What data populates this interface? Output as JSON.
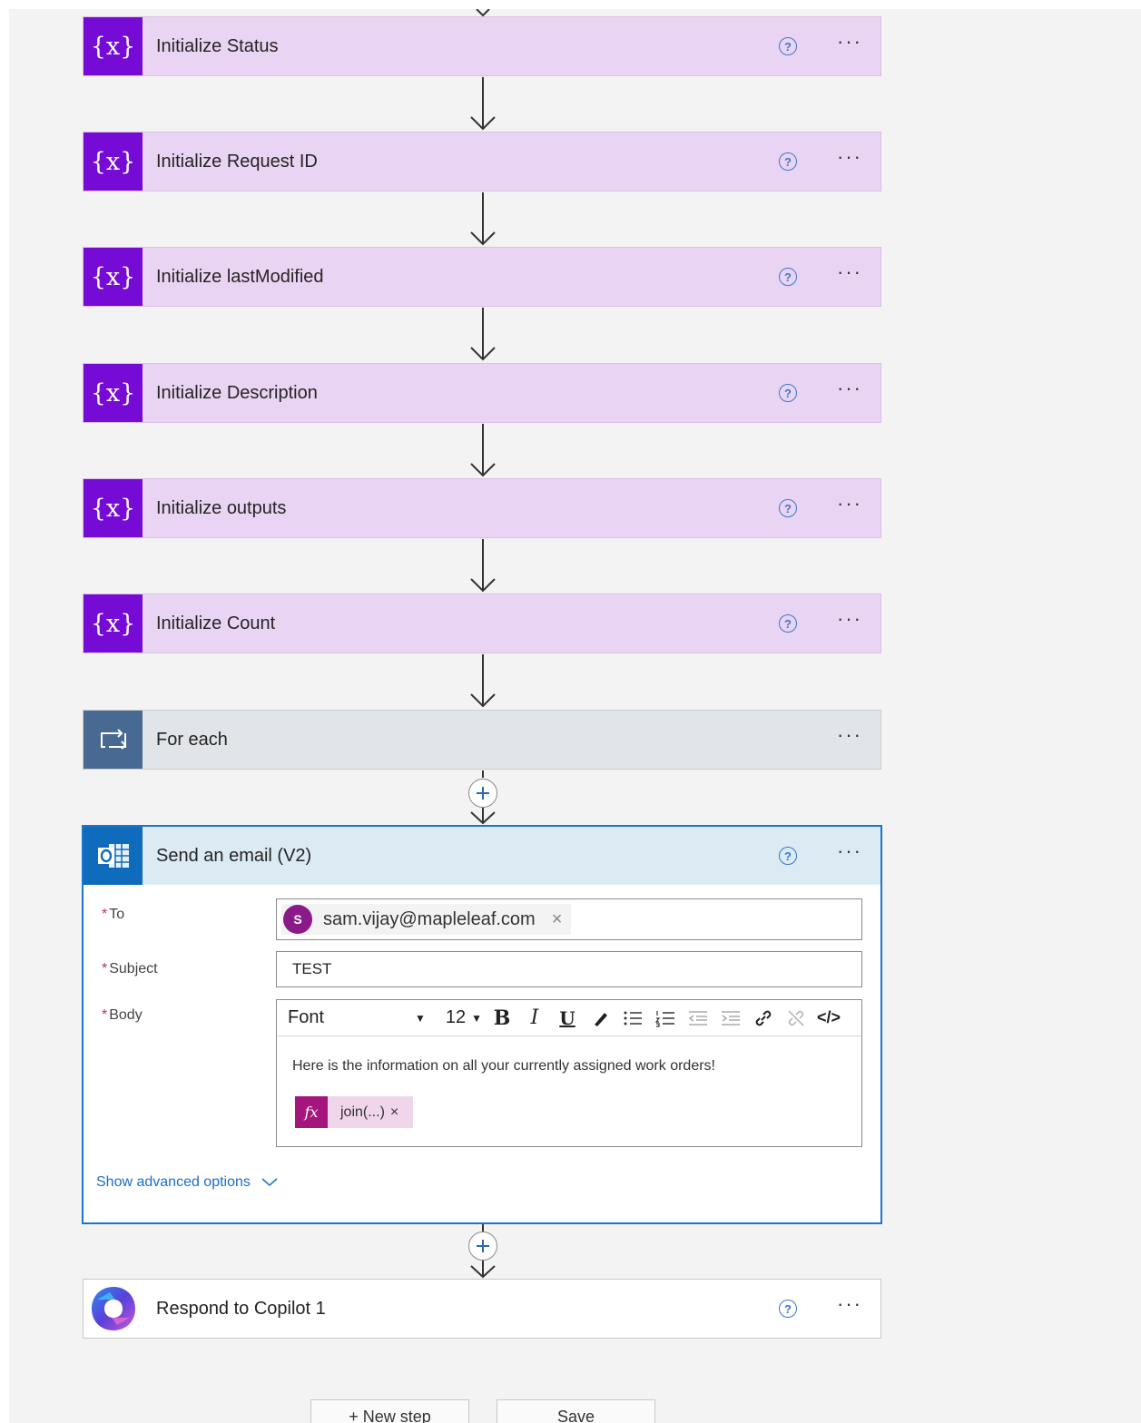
{
  "steps": [
    {
      "title": "Initialize Status"
    },
    {
      "title": "Initialize Request ID"
    },
    {
      "title": "Initialize lastModified"
    },
    {
      "title": "Initialize Description"
    },
    {
      "title": "Initialize outputs"
    },
    {
      "title": "Initialize Count"
    }
  ],
  "variable_icon_text": "{x}",
  "help_glyph": "?",
  "more_glyph": "···",
  "loop": {
    "title": "For each"
  },
  "email": {
    "title": "Send an email (V2)",
    "to_label": "To",
    "to_avatar": "S",
    "to_value": "sam.vijay@mapleleaf.com",
    "subject_label": "Subject",
    "subject_value": "TEST",
    "body_label": "Body",
    "required_mark": "*",
    "toolbar": {
      "font": "Font",
      "size": "12",
      "bold": "B",
      "italic": "I",
      "underline": "U",
      "code": "</>"
    },
    "body_text": "Here is the information on all your currently assigned work orders!",
    "fx_label": "fx",
    "fx_token": "join(...)",
    "remove_glyph": "×",
    "advanced_options": "Show advanced options"
  },
  "respond": {
    "title": "Respond to Copilot 1"
  },
  "buttons": {
    "new_step": "+ New step",
    "save": "Save"
  },
  "colors": {
    "variable_bg": "#ead4f3",
    "variable_icon": "#770bd6",
    "loop_icon": "#486991",
    "outlook_blue": "#0f6cbd",
    "selected_border": "#1a74d2",
    "fx_magenta": "#a4167c"
  }
}
